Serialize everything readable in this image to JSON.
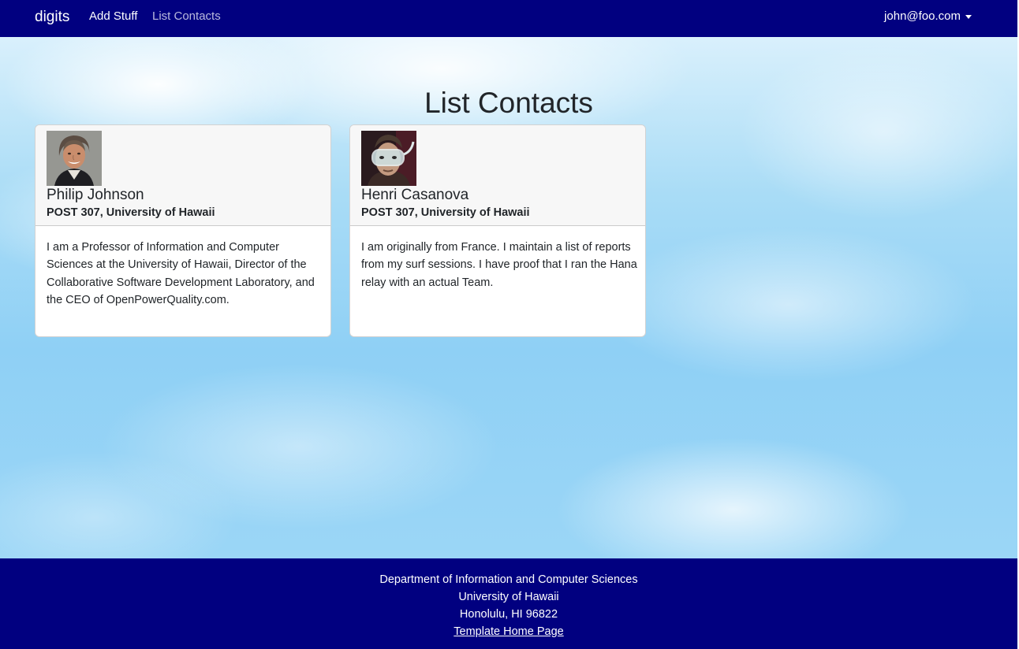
{
  "navbar": {
    "brand": "digits",
    "links": [
      {
        "label": "Add Stuff",
        "active": true
      },
      {
        "label": "List Contacts",
        "active": false
      }
    ],
    "user": "john@foo.com",
    "color": "#010080"
  },
  "page": {
    "title": "List Contacts"
  },
  "contacts": [
    {
      "name": "Philip Johnson",
      "address": "POST 307, University of Hawaii",
      "description": "I am a Professor of Information and Computer Sciences at the University of Hawaii, Director of the Collaborative Software Development Laboratory, and the CEO of OpenPowerQuality.com.",
      "avatar_icon": "person-photo"
    },
    {
      "name": "Henri Casanova",
      "address": "POST 307, University of Hawaii",
      "description": "I am originally from France. I maintain a list of reports from my surf sessions. I have proof that I ran the Hana relay with an actual Team.",
      "avatar_icon": "person-photo-goggles"
    }
  ],
  "footer": {
    "line1": "Department of Information and Computer Sciences",
    "line2": "University of Hawaii",
    "line3": "Honolulu, HI 96822",
    "link": "Template Home Page"
  }
}
